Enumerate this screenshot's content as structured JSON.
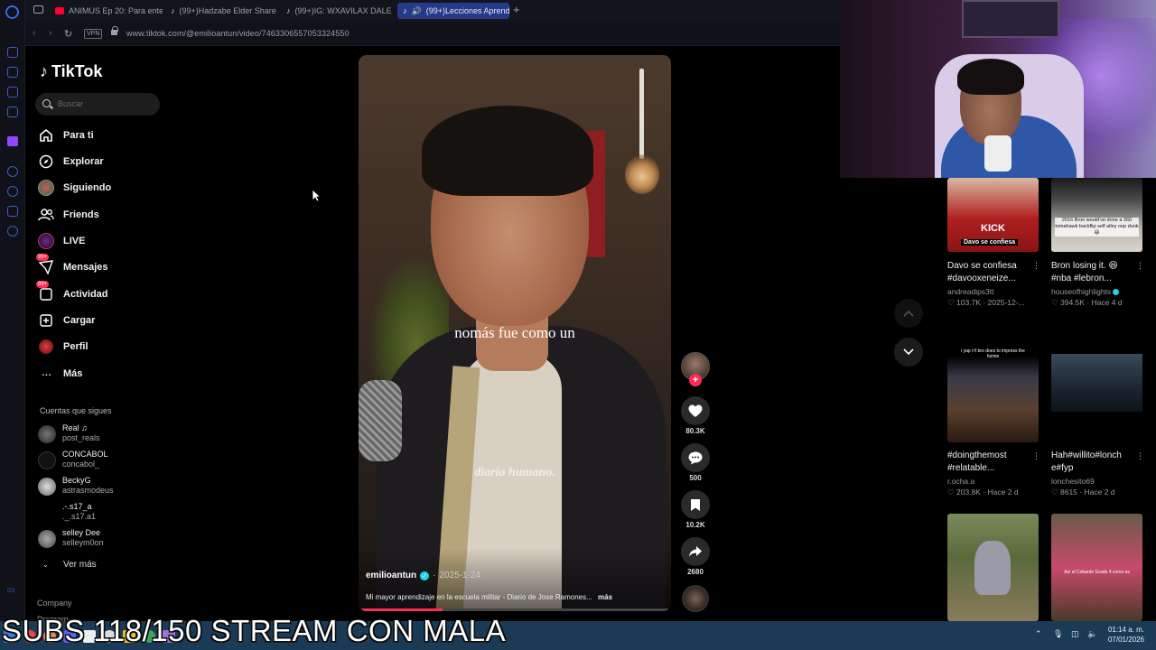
{
  "browser": {
    "tabs": [
      {
        "label": "ANIMUS Ep 20: Para enten",
        "icon": "youtube-icon",
        "color": "#ff0033"
      },
      {
        "label": "(99+)Hadzabe Elder Share",
        "icon": "tiktok-icon",
        "color": "#ffffff"
      },
      {
        "label": "(99+)IG: WXAVILAX DALE",
        "icon": "tiktok-icon",
        "color": "#ffffff"
      },
      {
        "label": "(99+)Lecciones Aprend",
        "icon": "tiktok-icon",
        "color": "#ffffff"
      }
    ],
    "vpn_label": "VPN",
    "url": "www.tiktok.com/@emilioantun/video/7463306557053324550"
  },
  "tiktok": {
    "logo_text": "TikTok",
    "search_placeholder": "Buscar",
    "nav": [
      {
        "label": "Para ti",
        "icon": "home-icon"
      },
      {
        "label": "Explorar",
        "icon": "compass-icon"
      },
      {
        "label": "Siguiendo",
        "icon": "following-avatar-icon"
      },
      {
        "label": "Friends",
        "icon": "friends-icon"
      },
      {
        "label": "LIVE",
        "icon": "live-icon"
      },
      {
        "label": "Mensajes",
        "icon": "messages-icon",
        "badge": "99+"
      },
      {
        "label": "Actividad",
        "icon": "activity-icon",
        "badge": "99+"
      },
      {
        "label": "Cargar",
        "icon": "upload-icon"
      },
      {
        "label": "Perfil",
        "icon": "profile-icon"
      },
      {
        "label": "Más",
        "icon": "more-icon"
      }
    ],
    "following_header": "Cuentas que sigues",
    "following": [
      {
        "name": "Real ♫",
        "handle": "post_reals"
      },
      {
        "name": "CONCABOL",
        "handle": "concabol_"
      },
      {
        "name": "BeckyG",
        "handle": "astrasmodeus"
      },
      {
        "name": ".-.s17_a",
        "handle": "._.s17.a1"
      },
      {
        "name": "selley Dee",
        "handle": "selleym0on"
      }
    ],
    "ver_mas": "Ver más",
    "footer": {
      "company": "Company",
      "program": "Program"
    }
  },
  "video": {
    "caption": "nomás fue como un",
    "watermark": "diario humano.",
    "author": "emilioantun",
    "date": "2025-1-24",
    "description": "Mi mayor aprendizaje en la escuela militar - Diario de Jose Ramones...",
    "more_label": "más",
    "progress_pct": 0.27,
    "likes": "80.3K",
    "comments": "500",
    "saves": "10.2K",
    "shares": "2680"
  },
  "recommended": [
    {
      "line1": "Davo se confiesa",
      "line2": "#davooxeneize...",
      "user": "andreadips3tt",
      "likes": "103.7K",
      "date": "2025-12-...",
      "verified": false,
      "thumb_text": "KICK",
      "thumb_sub": "Davo se confiesa"
    },
    {
      "line1": "Bron losing it. 😆",
      "line2": "#nba #lebron...",
      "user": "houseofhighlights",
      "likes": "394.5K",
      "date": "Hace 4 d",
      "verified": true,
      "thumb_text": "2016 Bron would've done a 360 tomahawk backflip self alley oop dunk 😆",
      "thumb_sub": ""
    },
    {
      "line1": "#doingthemost",
      "line2": "#relatable...",
      "user": "r.ocha.a",
      "likes": "203.8K",
      "date": "Hace 2 d",
      "verified": false,
      "thumb_text": "i yap n't bro does to impress the homie",
      "thumb_sub": ""
    },
    {
      "line1": "Hah#willito#lonch",
      "line2": "e#fyp",
      "user": "lonchesito69",
      "likes": "8615",
      "date": "Hace 2 d",
      "verified": false,
      "thumb_text": "",
      "thumb_sub": ""
    },
    {
      "line1": "",
      "line2": "",
      "user": "",
      "likes": "",
      "date": "",
      "verified": false,
      "thumb_text": "",
      "thumb_sub": ""
    },
    {
      "line1": "",
      "line2": "",
      "user": "",
      "likes": "",
      "date": "",
      "verified": false,
      "thumb_text": "Así el Cobarde Grade 4 como es",
      "thumb_sub": ""
    }
  ],
  "stream": {
    "overlay": "SUBS 118/150 STREAM CON MALA"
  },
  "taskbar": {
    "time": "01:14 a. m.",
    "date": "07/01/2026"
  },
  "colors": {
    "accent": "#fe2c55",
    "verified": "#20d5ec",
    "taskbar": "#1b3a55"
  }
}
